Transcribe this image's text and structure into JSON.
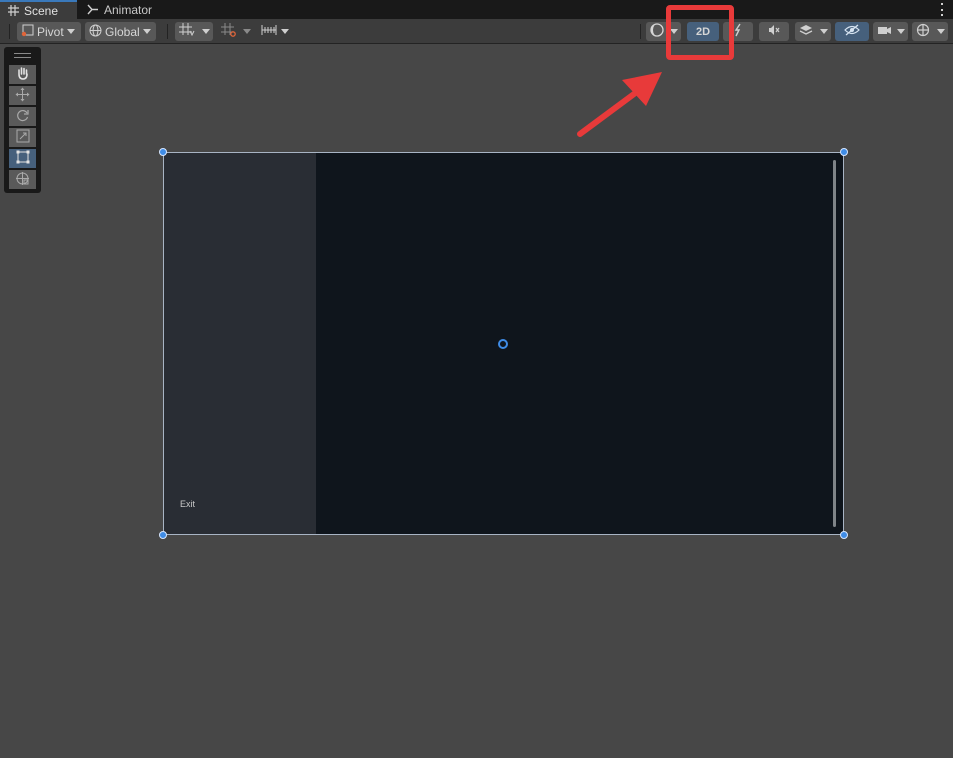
{
  "tabs": [
    {
      "label": "Scene",
      "icon": "grid-icon",
      "active": true
    },
    {
      "label": "Animator",
      "icon": "animator-icon",
      "active": false
    }
  ],
  "toolbar": {
    "pivot_label": "Pivot",
    "global_label": "Global",
    "mode_2d_label": "2D"
  },
  "canvas": {
    "exit_label": "Exit"
  },
  "colors": {
    "highlight": "#e83a3a",
    "selected": "#46607c",
    "handle": "#3f8ce6"
  }
}
